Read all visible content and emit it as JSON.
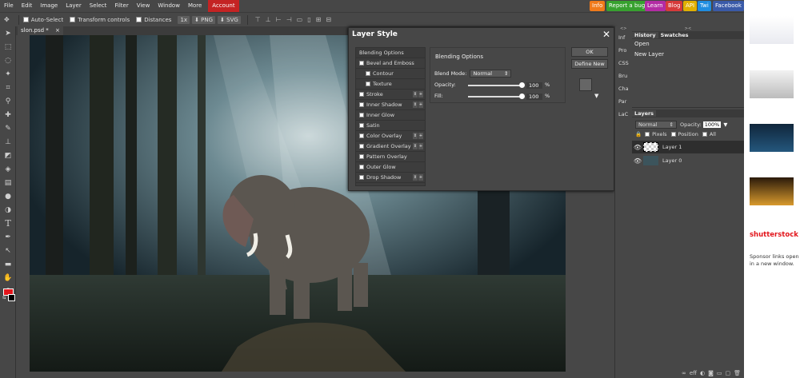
{
  "menubar": {
    "items": [
      "File",
      "Edit",
      "Image",
      "Layer",
      "Select",
      "Filter",
      "View",
      "Window",
      "More"
    ],
    "account": "Account",
    "pills": [
      {
        "label": "Info",
        "color": "#f07a1a"
      },
      {
        "label": "Report a bug",
        "color": "#37a12f"
      },
      {
        "label": "Learn",
        "color": "#b32ca4"
      },
      {
        "label": "Blog",
        "color": "#d63a3a"
      },
      {
        "label": "API",
        "color": "#e0b000"
      },
      {
        "label": "Twi",
        "color": "#1f8de0"
      },
      {
        "label": "Facebook",
        "color": "#3a5aa8"
      }
    ]
  },
  "options": {
    "auto_select": "Auto-Select",
    "transform": "Transform controls",
    "distances": "Distances",
    "zoom": "1x",
    "png": "PNG",
    "svg": "SVG"
  },
  "tab": {
    "name": "slon.psd *",
    "close": "×"
  },
  "dialog": {
    "title": "Layer Style",
    "close": "✕",
    "styles": [
      {
        "label": "Blending Options",
        "type": "head",
        "checkbox": false,
        "arrows": false
      },
      {
        "label": "Bevel and Emboss",
        "type": "item",
        "checkbox": true,
        "arrows": false
      },
      {
        "label": "Contour",
        "type": "sub",
        "checkbox": true,
        "arrows": false
      },
      {
        "label": "Texture",
        "type": "sub",
        "checkbox": true,
        "arrows": false
      },
      {
        "label": "Stroke",
        "type": "item",
        "checkbox": true,
        "arrows": true
      },
      {
        "label": "Inner Shadow",
        "type": "item",
        "checkbox": true,
        "arrows": true
      },
      {
        "label": "Inner Glow",
        "type": "item",
        "checkbox": true,
        "arrows": false
      },
      {
        "label": "Satin",
        "type": "item",
        "checkbox": true,
        "arrows": false
      },
      {
        "label": "Color Overlay",
        "type": "item",
        "checkbox": true,
        "arrows": true
      },
      {
        "label": "Gradient Overlay",
        "type": "item",
        "checkbox": true,
        "arrows": true
      },
      {
        "label": "Pattern Overlay",
        "type": "item",
        "checkbox": true,
        "arrows": false
      },
      {
        "label": "Outer Glow",
        "type": "item",
        "checkbox": true,
        "arrows": false
      },
      {
        "label": "Drop Shadow",
        "type": "item",
        "checkbox": true,
        "arrows": true
      }
    ],
    "blending": {
      "title": "Blending Options",
      "mode_label": "Blend Mode:",
      "mode_value": "Normal",
      "opacity_label": "Opacity:",
      "opacity_value": "100",
      "fill_label": "Fill:",
      "fill_value": "100",
      "percent": "%"
    },
    "ok": "OK",
    "define_new": "Define New"
  },
  "collapse": [
    "Inf",
    "Pro",
    "CSS",
    "Bru",
    "Cha",
    "Par",
    "LaC"
  ],
  "history": {
    "tabs": [
      "History",
      "Swatches"
    ],
    "items": [
      "Open",
      "New Layer"
    ]
  },
  "layers": {
    "title": "Layers",
    "blend": "Normal",
    "opacity_label": "Opacity:",
    "opacity_value": "100%",
    "lock_pixels": "Pixels",
    "lock_position": "Position",
    "lock_all": "All",
    "items": [
      "Layer 1",
      "Layer 0"
    ]
  },
  "ad": {
    "brand": "shutterstock",
    "sponsor": "Sponsor links open in a new window."
  },
  "colors": {
    "foreground": "#e2151b",
    "background": "#000000"
  }
}
